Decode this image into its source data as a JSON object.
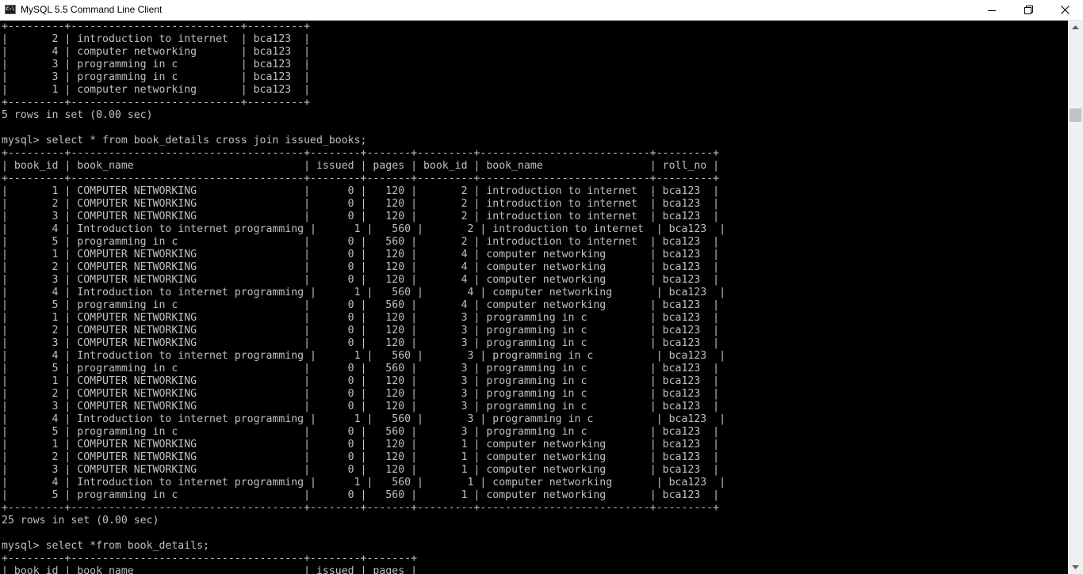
{
  "window": {
    "title": "MySQL 5.5 Command Line Client",
    "icon": "terminal-icon",
    "icon_text": "C:\\"
  },
  "controls": {
    "minimize": "minimize-icon",
    "maximize": "restore-icon",
    "close": "close-icon"
  },
  "colors": {
    "terminal_bg": "#000000",
    "terminal_fg": "#c0c0c0"
  },
  "scrollbar": {
    "up": "scroll-up-arrow-icon",
    "down": "scroll-down-arrow-icon"
  },
  "terminal": {
    "lines": [
      "+---------+---------------------------+---------+",
      "|       2 | introduction to internet  | bca123  |",
      "|       4 | computer networking       | bca123  |",
      "|       3 | programming in c          | bca123  |",
      "|       3 | programming in c          | bca123  |",
      "|       1 | computer networking       | bca123  |",
      "+---------+---------------------------+---------+",
      "5 rows in set (0.00 sec)",
      "",
      "mysql> select * from book_details cross join issued_books;",
      "+---------+-------------------------------------+--------+-------+---------+---------------------------+---------+",
      "| book_id | book_name                           | issued | pages | book_id | book_name                 | roll_no |",
      "+---------+-------------------------------------+--------+-------+---------+---------------------------+---------+",
      "|       1 | COMPUTER NETWORKING                 |      0 |   120 |       2 | introduction to internet  | bca123  |",
      "|       2 | COMPUTER NETWORKING                 |      0 |   120 |       2 | introduction to internet  | bca123  |",
      "|       3 | COMPUTER NETWORKING                 |      0 |   120 |       2 | introduction to internet  | bca123  |",
      "|       4 | Introduction to internet programming |      1 |   560 |       2 | introduction to internet  | bca123  |",
      "|       5 | programming in c                    |      0 |   560 |       2 | introduction to internet  | bca123  |",
      "|       1 | COMPUTER NETWORKING                 |      0 |   120 |       4 | computer networking       | bca123  |",
      "|       2 | COMPUTER NETWORKING                 |      0 |   120 |       4 | computer networking       | bca123  |",
      "|       3 | COMPUTER NETWORKING                 |      0 |   120 |       4 | computer networking       | bca123  |",
      "|       4 | Introduction to internet programming |      1 |   560 |       4 | computer networking       | bca123  |",
      "|       5 | programming in c                    |      0 |   560 |       4 | computer networking       | bca123  |",
      "|       1 | COMPUTER NETWORKING                 |      0 |   120 |       3 | programming in c          | bca123  |",
      "|       2 | COMPUTER NETWORKING                 |      0 |   120 |       3 | programming in c          | bca123  |",
      "|       3 | COMPUTER NETWORKING                 |      0 |   120 |       3 | programming in c          | bca123  |",
      "|       4 | Introduction to internet programming |      1 |   560 |       3 | programming in c          | bca123  |",
      "|       5 | programming in c                    |      0 |   560 |       3 | programming in c          | bca123  |",
      "|       1 | COMPUTER NETWORKING                 |      0 |   120 |       3 | programming in c          | bca123  |",
      "|       2 | COMPUTER NETWORKING                 |      0 |   120 |       3 | programming in c          | bca123  |",
      "|       3 | COMPUTER NETWORKING                 |      0 |   120 |       3 | programming in c          | bca123  |",
      "|       4 | Introduction to internet programming |      1 |   560 |       3 | programming in c          | bca123  |",
      "|       5 | programming in c                    |      0 |   560 |       3 | programming in c          | bca123  |",
      "|       1 | COMPUTER NETWORKING                 |      0 |   120 |       1 | computer networking       | bca123  |",
      "|       2 | COMPUTER NETWORKING                 |      0 |   120 |       1 | computer networking       | bca123  |",
      "|       3 | COMPUTER NETWORKING                 |      0 |   120 |       1 | computer networking       | bca123  |",
      "|       4 | Introduction to internet programming |      1 |   560 |       1 | computer networking       | bca123  |",
      "|       5 | programming in c                    |      0 |   560 |       1 | computer networking       | bca123  |",
      "+---------+-------------------------------------+--------+-------+---------+---------------------------+---------+",
      "25 rows in set (0.00 sec)",
      "",
      "mysql> select *from book_details;",
      "+---------+-------------------------------------+--------+-------+",
      "| book_id | book_name                           | issued | pages |"
    ]
  }
}
